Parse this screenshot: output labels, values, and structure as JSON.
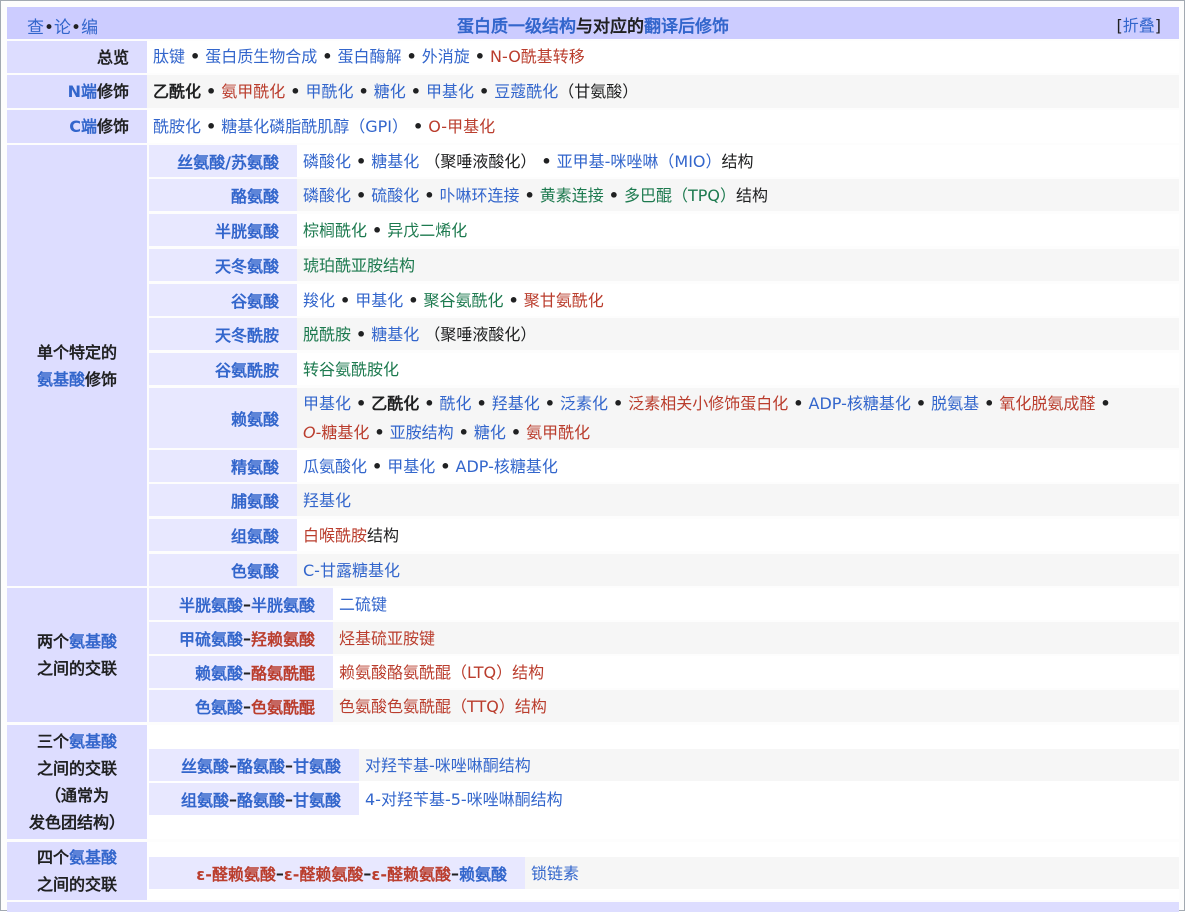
{
  "vte": {
    "view": "查",
    "talk": "论",
    "edit": "编"
  },
  "title": {
    "part1": "蛋白质一级结构",
    "part2": "与对应的",
    "part3": "翻译后修饰"
  },
  "toggle": "折叠",
  "overview": {
    "label": "总览",
    "items": [
      "肽键",
      "蛋白质生物合成",
      "蛋白酶解",
      "外消旋",
      "N-O酰基转移"
    ]
  },
  "nterm": {
    "label_a": "N端",
    "label_b": "修饰",
    "items": [
      "乙酰化",
      "氨甲酰化",
      "甲酰化",
      "糖化",
      "甲基化",
      "豆蔻酰化"
    ],
    "tail": "（甘氨酸）"
  },
  "cterm": {
    "label_a": "C端",
    "label_b": "修饰",
    "items": [
      "酰胺化",
      "糖基化磷脂酰肌醇（GPI）",
      "O-甲基化"
    ]
  },
  "single": {
    "label_a": "单个特定的",
    "label_b": "氨基酸",
    "label_c": "修饰",
    "rows": [
      {
        "name": "丝氨酸/苏氨酸",
        "a": "磷酸化",
        "b": "糖基化",
        "c": "（聚唾液酸化）",
        "d": "亚甲基-咪唑啉（MIO）",
        "e": "结构"
      },
      {
        "name": "酪氨酸",
        "a": "磷酸化",
        "b": "硫酸化",
        "c": "卟啉环连接",
        "d": "黄素连接",
        "e": "多巴醌（TPQ）",
        "f": "结构"
      },
      {
        "name": "半胱氨酸",
        "a": "棕榈酰化",
        "b": "异戊二烯化"
      },
      {
        "name": "天冬氨酸",
        "a": "琥珀酰亚胺结构"
      },
      {
        "name": "谷氨酸",
        "a": "羧化",
        "b": "甲基化",
        "c": "聚谷氨酰化",
        "d": "聚甘氨酰化"
      },
      {
        "name": "天冬酰胺",
        "a": "脱酰胺",
        "b": "糖基化",
        "c": "（聚唾液酸化）"
      },
      {
        "name": "谷氨酰胺",
        "a": "转谷氨酰胺化"
      },
      {
        "name": "赖氨酸",
        "l1": [
          "甲基化",
          "乙酰化",
          "酰化",
          "羟基化",
          "泛素化",
          "泛素相关小修饰蛋白化",
          "ADP-核糖基化",
          "脱氨基",
          "氧化脱氨成醛"
        ],
        "l2a": "O",
        "l2b": "-糖基化",
        "l2": [
          "亚胺结构",
          "糖化",
          "氨甲酰化"
        ]
      },
      {
        "name": "精氨酸",
        "a": "瓜氨酸化",
        "b": "甲基化",
        "c": "ADP-核糖基化"
      },
      {
        "name": "脯氨酸",
        "a": "羟基化"
      },
      {
        "name": "组氨酸",
        "a": "白喉酰胺",
        "b": "结构"
      },
      {
        "name": "色氨酸",
        "a": "C-甘露糖基化"
      }
    ]
  },
  "two": {
    "label_a": "两个",
    "label_b": "氨基酸",
    "label_c": "之间的交联",
    "rows": [
      {
        "n1": "半胱氨酸",
        "n2": "半胱氨酸",
        "v": "二硫键"
      },
      {
        "n1": "甲硫氨酸",
        "n2": "羟赖氨酸",
        "v": "烃基硫亚胺键"
      },
      {
        "n1": "赖氨酸",
        "n2": "酪氨酰醌",
        "v": "赖氨酸酪氨酰醌（LTQ）",
        "v2": "结构"
      },
      {
        "n1": "色氨酸",
        "n2": "色氨酰醌",
        "v": "色氨酸色氨酰醌（TTQ）",
        "v2": "结构"
      }
    ]
  },
  "three": {
    "label_a": "三个",
    "label_b": "氨基酸",
    "label_c": "之间的交联",
    "label_d": "（通常为",
    "label_e": "发色团结构）",
    "rows": [
      {
        "n1": "丝氨酸",
        "n2": "酪氨酸",
        "n3": "甘氨酸",
        "v": "对羟苄基-咪唑啉酮结构"
      },
      {
        "n1": "组氨酸",
        "n2": "酪氨酸",
        "n3": "甘氨酸",
        "v": "4-对羟苄基-5-咪唑啉酮结构"
      }
    ]
  },
  "four": {
    "label_a": "四个",
    "label_b": "氨基酸",
    "label_c": "之间的交联",
    "row": {
      "n1": "ε-醛赖氨酸",
      "n2": "ε-醛赖氨酸",
      "n3": "ε-醛赖氨酸",
      "n4": "赖氨酸",
      "v": "锁链素"
    }
  },
  "sep": "–",
  "bullet": "•"
}
